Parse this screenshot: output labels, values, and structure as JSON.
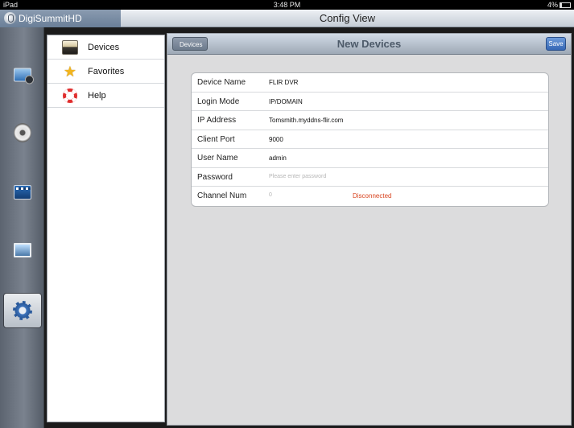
{
  "status_bar": {
    "device": "iPad",
    "time": "3:48 PM",
    "battery": "4%"
  },
  "app": {
    "name": "DigiSummitHD",
    "title": "Config View"
  },
  "rail": {
    "items": [
      {
        "icon": "live-view-icon"
      },
      {
        "icon": "playback-reel-icon"
      },
      {
        "icon": "video-clip-icon"
      },
      {
        "icon": "picture-icon"
      },
      {
        "icon": "settings-gear-icon",
        "selected": true
      }
    ]
  },
  "menu": {
    "items": [
      {
        "label": "Devices",
        "icon": "devices-icon"
      },
      {
        "label": "Favorites",
        "icon": "star-icon"
      },
      {
        "label": "Help",
        "icon": "lifebuoy-icon"
      }
    ]
  },
  "panel": {
    "back_label": "Devices",
    "title": "New Devices",
    "save_label": "Save"
  },
  "form": {
    "device_name": {
      "label": "Device Name",
      "value": "FLIR DVR"
    },
    "login_mode": {
      "label": "Login Mode",
      "value": "IP/DOMAIN"
    },
    "ip_address": {
      "label": "IP Address",
      "value": "Tomsmith.myddns-flir.com"
    },
    "client_port": {
      "label": "Client Port",
      "value": "9000"
    },
    "user_name": {
      "label": "User Name",
      "value": "admin"
    },
    "password": {
      "label": "Password",
      "placeholder": "Please enter password"
    },
    "channel_num": {
      "label": "Channel Num",
      "value": "0",
      "status": "Disconnected"
    }
  },
  "colors": {
    "status_disconnected": "#d8431e",
    "save_button": "#3466b4",
    "nav_title": "#4d5a69"
  }
}
